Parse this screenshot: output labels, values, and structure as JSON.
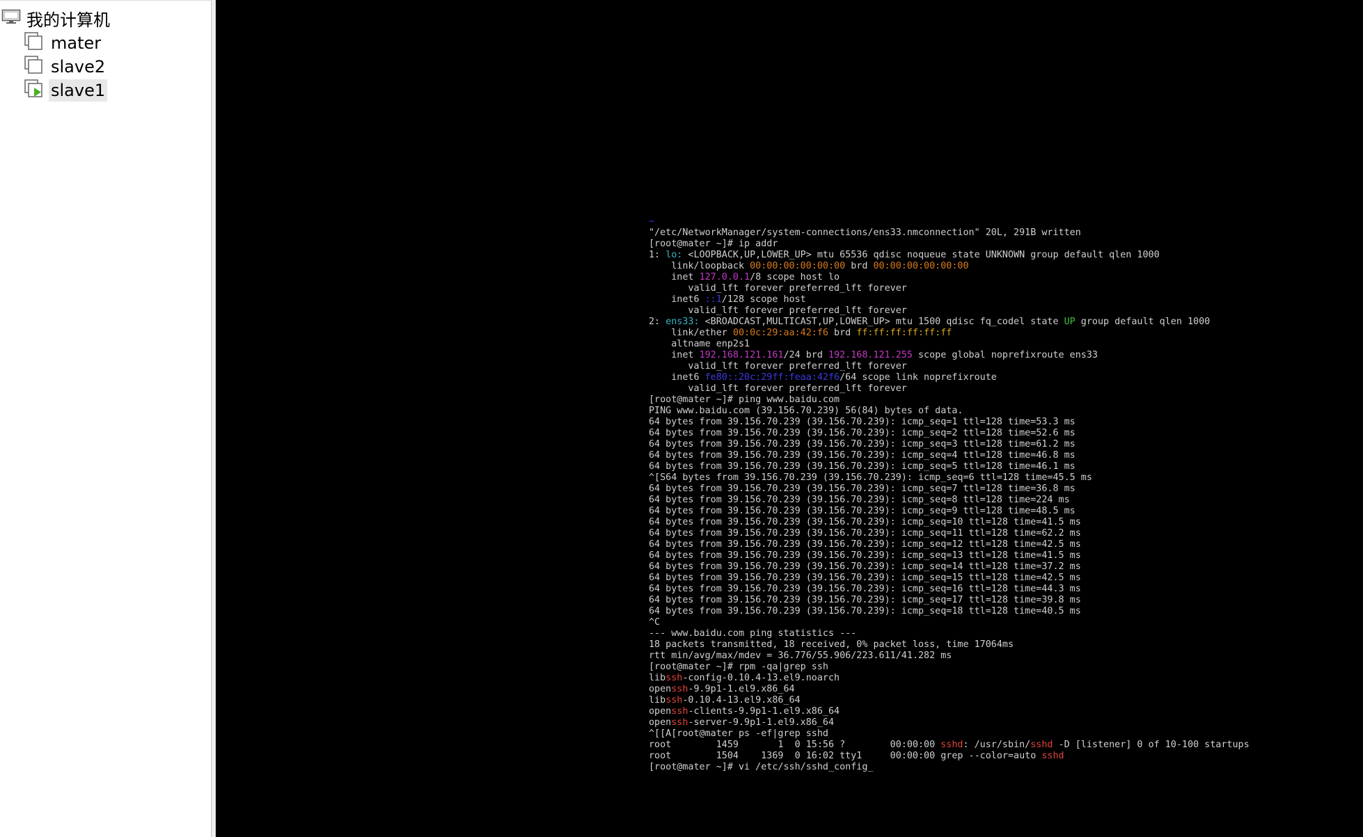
{
  "sidebar": {
    "root_label": "我的计算机",
    "items": [
      {
        "label": "mater",
        "running": false,
        "selected": false
      },
      {
        "label": "slave2",
        "running": false,
        "selected": false
      },
      {
        "label": "slave1",
        "running": true,
        "selected": true
      }
    ]
  },
  "colors": {
    "cyan": "#35b6c6",
    "orange": "#d77a1c",
    "magenta": "#c339c3",
    "blue": "#3a3ae0",
    "green": "#3fbf3f",
    "yellow": "#d4a21a",
    "red": "#e0443a",
    "text": "#d0d0d0",
    "background": "#000000",
    "play_icon": "#4caf24"
  },
  "terminal": {
    "lines": [
      [
        {
          "t": "~",
          "c": "tilde"
        }
      ],
      [
        {
          "t": "\"/etc/NetworkManager/system-connections/ens33.nmconnection\" 20L, 291B written"
        }
      ],
      [
        {
          "t": "[root@mater ~]# ip addr"
        }
      ],
      [
        {
          "t": "1: "
        },
        {
          "t": "lo:",
          "c": "cyan"
        },
        {
          "t": " <LOOPBACK,UP,LOWER_UP> mtu 65536 qdisc noqueue state UNKNOWN group default qlen 1000"
        }
      ],
      [
        {
          "t": "    link/loopback "
        },
        {
          "t": "00:00:00:00:00:00",
          "c": "orange"
        },
        {
          "t": " brd "
        },
        {
          "t": "00:00:00:00:00:00",
          "c": "orange"
        }
      ],
      [
        {
          "t": "    inet "
        },
        {
          "t": "127.0.0.1",
          "c": "magenta"
        },
        {
          "t": "/8 scope host lo"
        }
      ],
      [
        {
          "t": "       valid_lft forever preferred_lft forever"
        }
      ],
      [
        {
          "t": "    inet6 "
        },
        {
          "t": "::1",
          "c": "blue"
        },
        {
          "t": "/128 scope host"
        }
      ],
      [
        {
          "t": "       valid_lft forever preferred_lft forever"
        }
      ],
      [
        {
          "t": "2: "
        },
        {
          "t": "ens33:",
          "c": "cyan"
        },
        {
          "t": " <BROADCAST,MULTICAST,UP,LOWER_UP> mtu 1500 qdisc fq_codel state "
        },
        {
          "t": "UP",
          "c": "green"
        },
        {
          "t": " group default qlen 1000"
        }
      ],
      [
        {
          "t": "    link/ether "
        },
        {
          "t": "00:0c:29:aa:42:f6",
          "c": "orange"
        },
        {
          "t": " brd "
        },
        {
          "t": "ff:ff:ff:ff:ff:ff",
          "c": "yellow"
        }
      ],
      [
        {
          "t": "    altname enp2s1"
        }
      ],
      [
        {
          "t": "    inet "
        },
        {
          "t": "192.168.121.161",
          "c": "magenta"
        },
        {
          "t": "/24 brd "
        },
        {
          "t": "192.168.121.255",
          "c": "magenta"
        },
        {
          "t": " scope global noprefixroute ens33"
        }
      ],
      [
        {
          "t": "       valid_lft forever preferred_lft forever"
        }
      ],
      [
        {
          "t": "    inet6 "
        },
        {
          "t": "fe80::20c:29ff:feaa:42f6",
          "c": "blue"
        },
        {
          "t": "/64 scope link noprefixroute"
        }
      ],
      [
        {
          "t": "       valid_lft forever preferred_lft forever"
        }
      ],
      [
        {
          "t": "[root@mater ~]# ping www.baidu.com"
        }
      ],
      [
        {
          "t": "PING www.baidu.com (39.156.70.239) 56(84) bytes of data."
        }
      ],
      [
        {
          "t": "64 bytes from 39.156.70.239 (39.156.70.239): icmp_seq=1 ttl=128 time=53.3 ms"
        }
      ],
      [
        {
          "t": "64 bytes from 39.156.70.239 (39.156.70.239): icmp_seq=2 ttl=128 time=52.6 ms"
        }
      ],
      [
        {
          "t": "64 bytes from 39.156.70.239 (39.156.70.239): icmp_seq=3 ttl=128 time=61.2 ms"
        }
      ],
      [
        {
          "t": "64 bytes from 39.156.70.239 (39.156.70.239): icmp_seq=4 ttl=128 time=46.8 ms"
        }
      ],
      [
        {
          "t": "64 bytes from 39.156.70.239 (39.156.70.239): icmp_seq=5 ttl=128 time=46.1 ms"
        }
      ],
      [
        {
          "t": "^[S64 bytes from 39.156.70.239 (39.156.70.239): icmp_seq=6 ttl=128 time=45.5 ms"
        }
      ],
      [
        {
          "t": "64 bytes from 39.156.70.239 (39.156.70.239): icmp_seq=7 ttl=128 time=36.8 ms"
        }
      ],
      [
        {
          "t": "64 bytes from 39.156.70.239 (39.156.70.239): icmp_seq=8 ttl=128 time=224 ms"
        }
      ],
      [
        {
          "t": "64 bytes from 39.156.70.239 (39.156.70.239): icmp_seq=9 ttl=128 time=48.5 ms"
        }
      ],
      [
        {
          "t": "64 bytes from 39.156.70.239 (39.156.70.239): icmp_seq=10 ttl=128 time=41.5 ms"
        }
      ],
      [
        {
          "t": "64 bytes from 39.156.70.239 (39.156.70.239): icmp_seq=11 ttl=128 time=62.2 ms"
        }
      ],
      [
        {
          "t": "64 bytes from 39.156.70.239 (39.156.70.239): icmp_seq=12 ttl=128 time=42.5 ms"
        }
      ],
      [
        {
          "t": "64 bytes from 39.156.70.239 (39.156.70.239): icmp_seq=13 ttl=128 time=41.5 ms"
        }
      ],
      [
        {
          "t": "64 bytes from 39.156.70.239 (39.156.70.239): icmp_seq=14 ttl=128 time=37.2 ms"
        }
      ],
      [
        {
          "t": "64 bytes from 39.156.70.239 (39.156.70.239): icmp_seq=15 ttl=128 time=42.5 ms"
        }
      ],
      [
        {
          "t": "64 bytes from 39.156.70.239 (39.156.70.239): icmp_seq=16 ttl=128 time=44.3 ms"
        }
      ],
      [
        {
          "t": "64 bytes from 39.156.70.239 (39.156.70.239): icmp_seq=17 ttl=128 time=39.8 ms"
        }
      ],
      [
        {
          "t": "64 bytes from 39.156.70.239 (39.156.70.239): icmp_seq=18 ttl=128 time=40.5 ms"
        }
      ],
      [
        {
          "t": "^C"
        }
      ],
      [
        {
          "t": "--- www.baidu.com ping statistics ---"
        }
      ],
      [
        {
          "t": "18 packets transmitted, 18 received, 0% packet loss, time 17064ms"
        }
      ],
      [
        {
          "t": "rtt min/avg/max/mdev = 36.776/55.906/223.611/41.282 ms"
        }
      ],
      [
        {
          "t": "[root@mater ~]# rpm -qa|grep ssh"
        }
      ],
      [
        {
          "t": "lib"
        },
        {
          "t": "ssh",
          "c": "red"
        },
        {
          "t": "-config-0.10.4-13.el9.noarch"
        }
      ],
      [
        {
          "t": "open"
        },
        {
          "t": "ssh",
          "c": "red"
        },
        {
          "t": "-9.9p1-1.el9.x86_64"
        }
      ],
      [
        {
          "t": "lib"
        },
        {
          "t": "ssh",
          "c": "red"
        },
        {
          "t": "-0.10.4-13.el9.x86_64"
        }
      ],
      [
        {
          "t": "open"
        },
        {
          "t": "ssh",
          "c": "red"
        },
        {
          "t": "-clients-9.9p1-1.el9.x86_64"
        }
      ],
      [
        {
          "t": "open"
        },
        {
          "t": "ssh",
          "c": "red"
        },
        {
          "t": "-server-9.9p1-1.el9.x86_64"
        }
      ],
      [
        {
          "t": "^[[A[root@mater ps -ef|grep sshd"
        }
      ],
      [
        {
          "t": "root        1459       1  0 15:56 ?        00:00:00 "
        },
        {
          "t": "sshd",
          "c": "red"
        },
        {
          "t": ": /usr/sbin/"
        },
        {
          "t": "sshd",
          "c": "red"
        },
        {
          "t": " -D [listener] 0 of 10-100 startups"
        }
      ],
      [
        {
          "t": "root        1504    1369  0 16:02 tty1     00:00:00 grep --color=auto "
        },
        {
          "t": "sshd",
          "c": "red"
        }
      ],
      [
        {
          "t": "[root@mater ~]# vi /etc/ssh/sshd_config_"
        }
      ]
    ]
  }
}
